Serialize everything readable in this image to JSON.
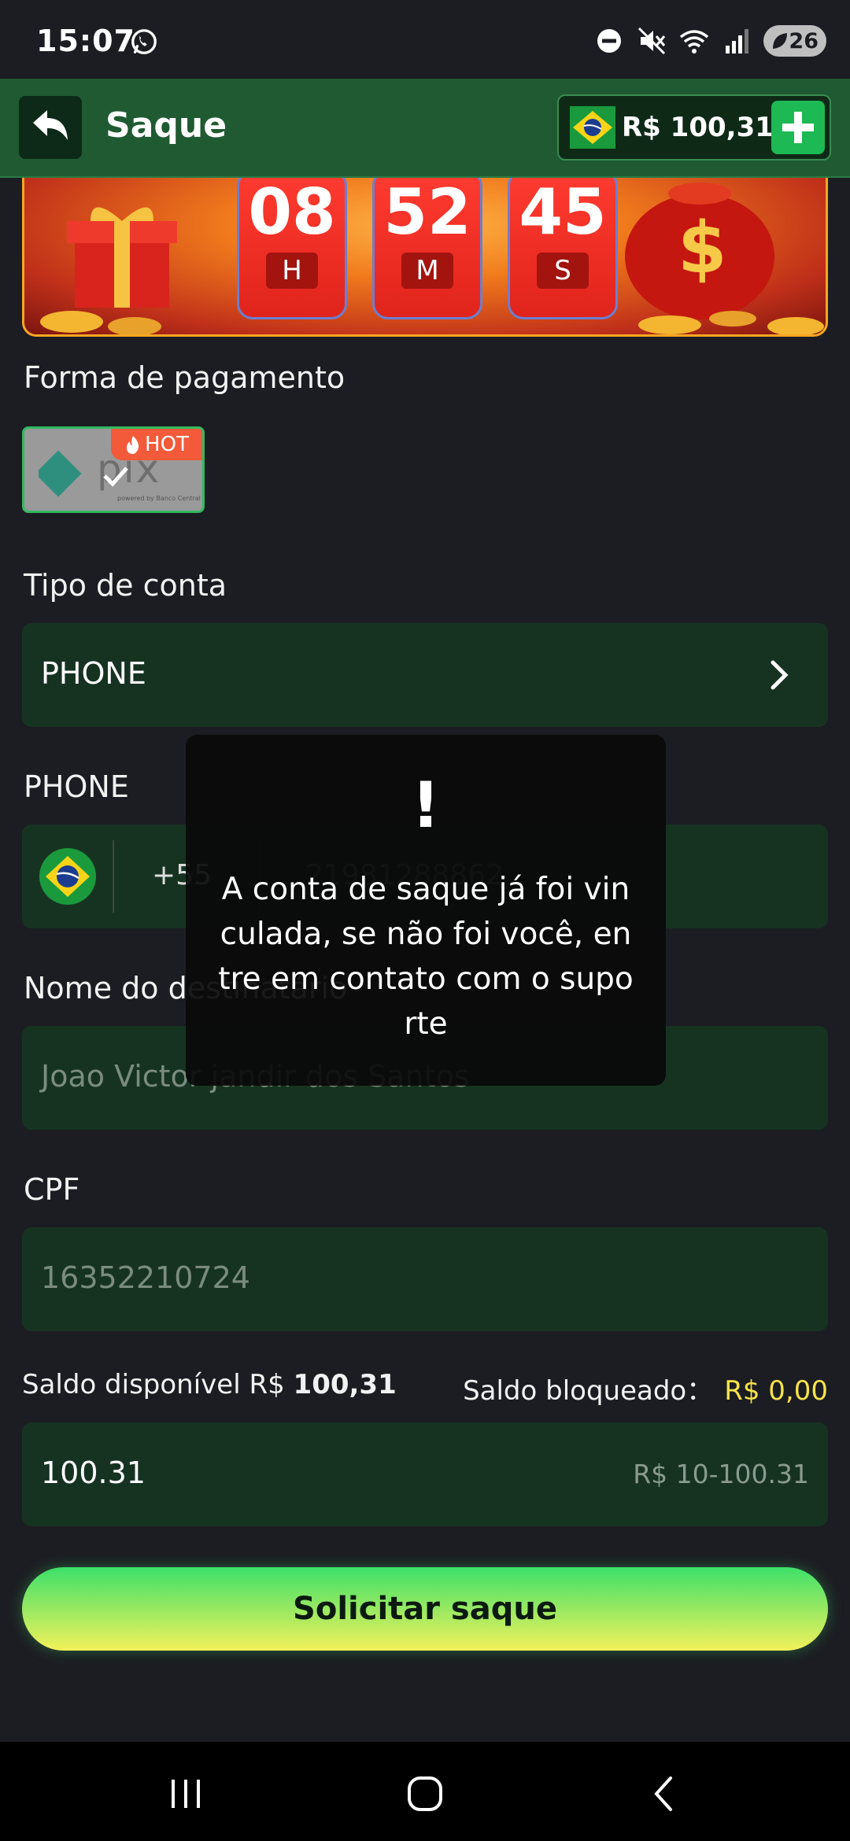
{
  "status_bar": {
    "time": "15:07",
    "battery": "26",
    "icons": [
      "whatsapp-icon",
      "do-not-disturb-icon",
      "mute-icon",
      "wifi-icon",
      "signal-icon",
      "battery-icon"
    ]
  },
  "header": {
    "title": "Saque",
    "balance": "R$ 100,31",
    "back_icon": "back-arrow-icon",
    "add_icon": "plus-icon",
    "flag": "brazil-flag"
  },
  "banner": {
    "timer": [
      {
        "value": "08",
        "unit": "H"
      },
      {
        "value": "52",
        "unit": "M"
      },
      {
        "value": "45",
        "unit": "S"
      }
    ]
  },
  "payment": {
    "label": "Forma de pagamento",
    "method_name": "pix",
    "method_sub": "powered by Banco Central",
    "badge": "HOT"
  },
  "account_type": {
    "label": "Tipo de conta",
    "value": "PHONE"
  },
  "phone": {
    "label": "PHONE",
    "country_code": "+55",
    "number": "21981288862"
  },
  "recipient": {
    "label": "Nome do destinatário",
    "value": "Joao Victor jandir dos Santos"
  },
  "cpf": {
    "label": "CPF",
    "value": "16352210724"
  },
  "saldo": {
    "available_label": "Saldo disponível R$",
    "available_value": "100,31",
    "blocked_label": "Saldo bloqueado：",
    "blocked_value": "R$ 0,00"
  },
  "amount": {
    "value": "100.31",
    "range": "R$ 10-100.31"
  },
  "submit": {
    "label": "Solicitar saque"
  },
  "toast": {
    "icon": "!",
    "message": "A conta de saque já foi vinculada, se não foi você, entre em contato com o suporte"
  },
  "colors": {
    "header_bg": "#1f5a32",
    "field_bg": "#163322",
    "accent_green": "#1db954",
    "accent_yellow": "#f7e34a",
    "timer_red": "#ff3b30"
  }
}
